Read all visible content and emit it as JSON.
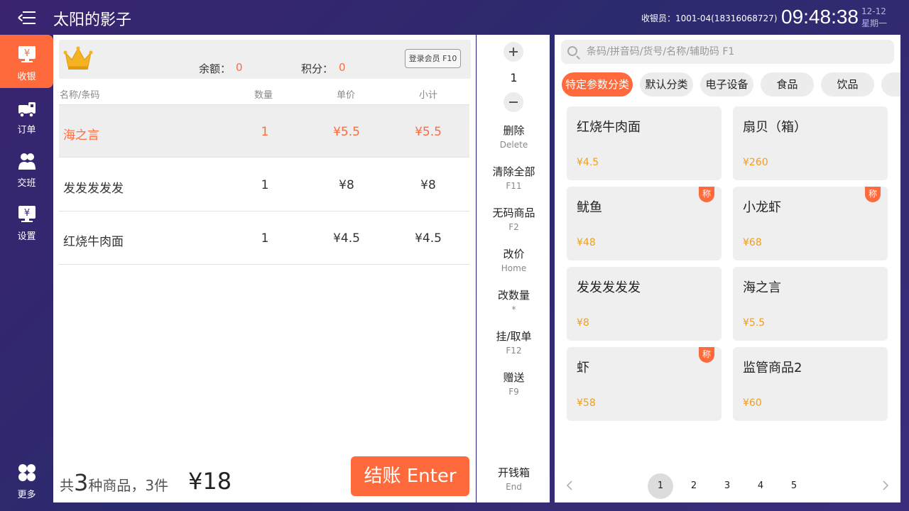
{
  "header": {
    "title": "太阳的影子",
    "cashier": "收银员：1001-04(18316068727)",
    "time": "09:48:38",
    "date": "12-12",
    "weekday": "星期一"
  },
  "sidebar": {
    "items": [
      {
        "label": "收银",
        "icon": "cashier-icon"
      },
      {
        "label": "订单",
        "icon": "order-icon"
      },
      {
        "label": "交班",
        "icon": "shift-icon"
      },
      {
        "label": "设置",
        "icon": "settings-icon"
      },
      {
        "label": "更多",
        "icon": "more-icon"
      }
    ]
  },
  "member": {
    "balance_label": "余额：",
    "balance_value": "0",
    "points_label": "积分：",
    "points_value": "0",
    "login_label": "登录会员 F10"
  },
  "order": {
    "columns": [
      "名称/条码",
      "数量",
      "单价",
      "小计"
    ],
    "rows": [
      {
        "name": "海之言",
        "qty": "1",
        "price": "¥5.5",
        "subtotal": "¥5.5"
      },
      {
        "name": "发发发发发",
        "qty": "1",
        "price": "¥8",
        "subtotal": "¥8"
      },
      {
        "name": "红烧牛肉面",
        "qty": "1",
        "price": "¥4.5",
        "subtotal": "¥4.5"
      }
    ],
    "summary_prefix": "共",
    "kinds": "3",
    "summary_mid": "种商品，",
    "count": "3",
    "summary_suffix": "件",
    "total": "¥18",
    "checkout_label": "结账 Enter"
  },
  "actions": {
    "qty": "1",
    "items": [
      {
        "label": "删除",
        "key": "Delete"
      },
      {
        "label": "清除全部",
        "key": "F11"
      },
      {
        "label": "无码商品",
        "key": "F2"
      },
      {
        "label": "改价",
        "key": "Home"
      },
      {
        "label": "改数量",
        "key": "*"
      },
      {
        "label": "挂/取单",
        "key": "F12"
      },
      {
        "label": "赠送",
        "key": "F9"
      }
    ],
    "drawer": {
      "label": "开钱箱",
      "key": "End"
    }
  },
  "products": {
    "search_placeholder": "条码/拼音码/货号/名称/辅助码 F1",
    "categories": [
      "特定参数分类",
      "默认分类",
      "电子设备",
      "食品",
      "饮品",
      ""
    ],
    "items": [
      {
        "name": "红烧牛肉面",
        "price": "¥4.5",
        "tag": ""
      },
      {
        "name": "扇贝（箱）",
        "price": "¥260",
        "tag": ""
      },
      {
        "name": "鱿鱼",
        "price": "¥48",
        "tag": "称"
      },
      {
        "name": "小龙虾",
        "price": "¥68",
        "tag": "称"
      },
      {
        "name": "发发发发发",
        "price": "¥8",
        "tag": ""
      },
      {
        "name": "海之言",
        "price": "¥5.5",
        "tag": ""
      },
      {
        "name": "虾",
        "price": "¥58",
        "tag": "称"
      },
      {
        "name": "监管商品2",
        "price": "¥60",
        "tag": ""
      }
    ],
    "pages": [
      "1",
      "2",
      "3",
      "4",
      "5"
    ]
  },
  "colors": {
    "accent": "#ff6a3d",
    "price": "#f29e1c",
    "background": "#3a2470"
  }
}
